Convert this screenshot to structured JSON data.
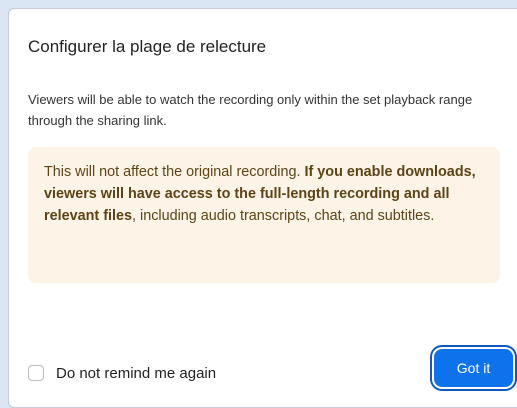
{
  "dialog": {
    "title": "Configurer la plage de relecture",
    "description": "Viewers will be able to watch the recording only within the set playback range through the sharing link.",
    "notice": {
      "text_intro": "This will not affect the original recording. ",
      "text_bold": "If you enable downloads, viewers will have access to the full-length recording and all relevant files",
      "text_outro": ", including audio transcripts, chat, and subtitles."
    },
    "checkbox": {
      "label": "Do not remind me again",
      "checked": false
    },
    "confirm_button": {
      "label": "Got it"
    }
  },
  "colors": {
    "accent": "#0e72ed",
    "notice_background": "#fdf3e6",
    "notice_text": "#5c4416",
    "page_background": "#dbe6f4"
  }
}
